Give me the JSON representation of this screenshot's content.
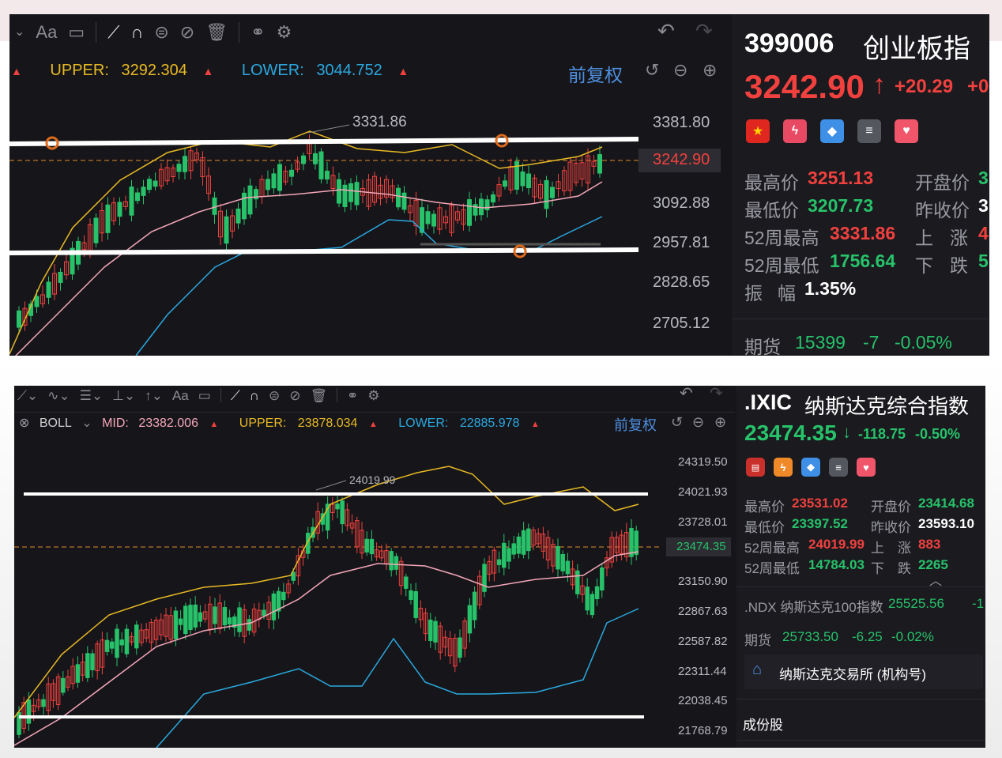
{
  "top": {
    "indicator": {
      "upper_label": "UPPER:",
      "upper_value": "3292.304",
      "lower_label": "LOWER:",
      "lower_value": "3044.752",
      "adjust_label": "前复权"
    },
    "price_axis": [
      "3381.80",
      "3092.88",
      "2957.81",
      "2828.65",
      "2705.12"
    ],
    "current_price_tag": "3242.90",
    "high_marker": "3331.86",
    "quote": {
      "code": "399006",
      "name": "创业板指",
      "price": "3242.90",
      "change": "+20.29",
      "change_pct_partial": "+0"
    },
    "stats": {
      "high_label": "最高价",
      "high": "3251.13",
      "open_label": "开盘价",
      "open_partial": "3",
      "low_label": "最低价",
      "low": "3207.73",
      "prev_label": "昨收价",
      "prev_partial": "3",
      "wk52_high_label": "52周最高",
      "wk52_high": "3331.86",
      "up_label_a": "上",
      "up_label_b": "涨",
      "up_partial": "4",
      "wk52_low_label": "52周最低",
      "wk52_low": "1756.64",
      "down_label_a": "下",
      "down_label_b": "跌",
      "down_partial": "5",
      "amp_label_a": "振",
      "amp_label_b": "幅",
      "amp": "1.35%"
    },
    "futures": {
      "label": "期货",
      "price": "15399",
      "change": "-7",
      "pct": "-0.05%"
    },
    "icons": [
      "china-flag-icon",
      "flash-icon",
      "tag-icon",
      "note-icon",
      "heart-icon"
    ]
  },
  "bottom": {
    "indicator": {
      "name": "BOLL",
      "mid_label": "MID:",
      "mid_value": "23382.006",
      "upper_label": "UPPER:",
      "upper_value": "23878.034",
      "lower_label": "LOWER:",
      "lower_value": "22885.978",
      "adjust_label": "前复权"
    },
    "price_axis": [
      "24319.50",
      "24021.93",
      "23728.01",
      "23150.90",
      "22867.63",
      "22587.82",
      "22311.44",
      "22038.45",
      "21768.79"
    ],
    "current_price_tag": "23474.35",
    "high_marker": "24019.99",
    "quote": {
      "code": ".IXIC",
      "name": "纳斯达克综合指数",
      "price": "23474.35",
      "change": "-118.75",
      "change_pct": "-0.50%"
    },
    "stats": {
      "high_label": "最高价",
      "high": "23531.02",
      "open_label": "开盘价",
      "open": "23414.68",
      "low_label": "最低价",
      "low": "23397.52",
      "prev_label": "昨收价",
      "prev": "23593.10",
      "wk52_high_label": "52周最高",
      "wk52_high": "24019.99",
      "up_label_a": "上",
      "up_label_b": "涨",
      "up": "883",
      "wk52_low_label": "52周最低",
      "wk52_low": "14784.03",
      "down_label_a": "下",
      "down_label_b": "跌",
      "down": "2265"
    },
    "related": {
      "name": ".NDX 纳斯达克100指数",
      "price": "25525.56",
      "change_partial": "-1"
    },
    "futures": {
      "label": "期货",
      "price": "25733.50",
      "change": "-6.25",
      "pct": "-0.02%"
    },
    "exchange": "纳斯达克交易所 (机构号)",
    "constituents": "成份股",
    "icons": [
      "us-flag-icon",
      "flash-icon",
      "tag-icon",
      "note-icon",
      "heart-icon"
    ]
  },
  "colors": {
    "up": "#f0413e",
    "down": "#27c26a",
    "upper_band": "#e8b923",
    "lower_band": "#2aa8e0",
    "mid_band": "#f4a6b8"
  }
}
